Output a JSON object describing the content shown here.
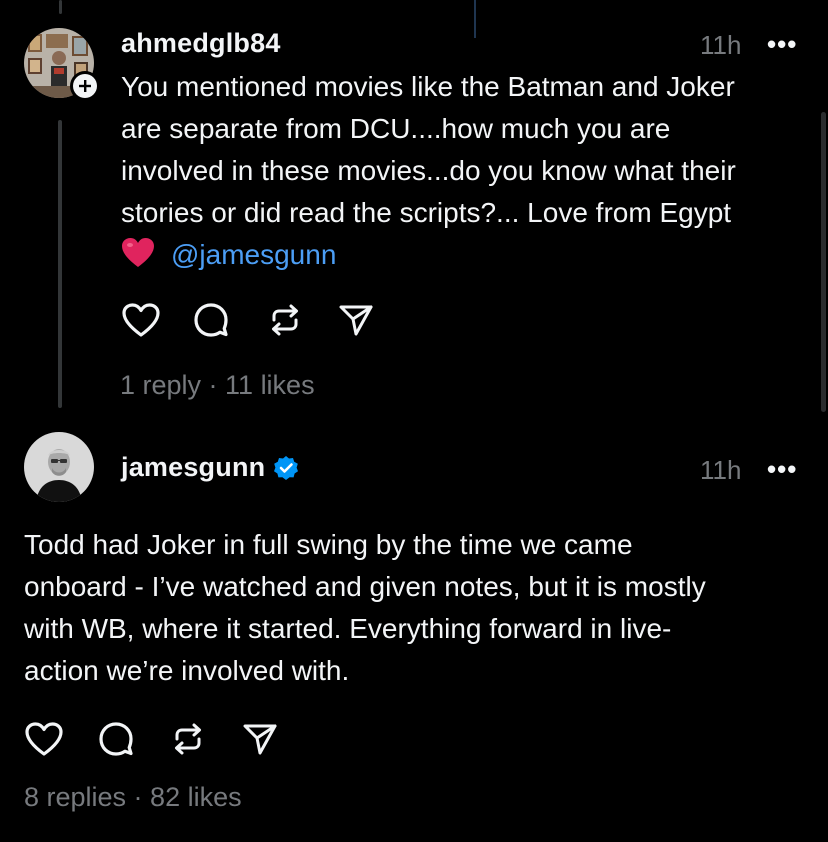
{
  "post1": {
    "username": "ahmedglb84",
    "time": "11h",
    "more": "•••",
    "lines": [
      "You mentioned movies like the Batman and Joker",
      "are separate from DCU....how much you are",
      "involved in these movies...do you know what their",
      "stories or did read the scripts?... Love from Egypt"
    ],
    "heart_emoji": "❤️",
    "mention": "@jamesgunn",
    "stats": "1 reply · 11 likes",
    "follow_icon": "plus-icon"
  },
  "post2": {
    "username": "jamesgunn",
    "time": "11h",
    "more": "•••",
    "verified_icon": "verified-badge-icon",
    "lines": [
      "Todd had Joker in full swing by the time we came",
      "onboard - I’ve watched and given notes, but it is mostly",
      "with WB, where it started. Everything forward in live-",
      "action we’re involved with."
    ],
    "stats": "8 replies · 82 likes"
  },
  "colors": {
    "background": "#000000",
    "text": "#f3f5f7",
    "secondary": "#777a7e",
    "mention": "#4c9ef5",
    "verified": "#0095f6",
    "heart": "#e0245e"
  }
}
